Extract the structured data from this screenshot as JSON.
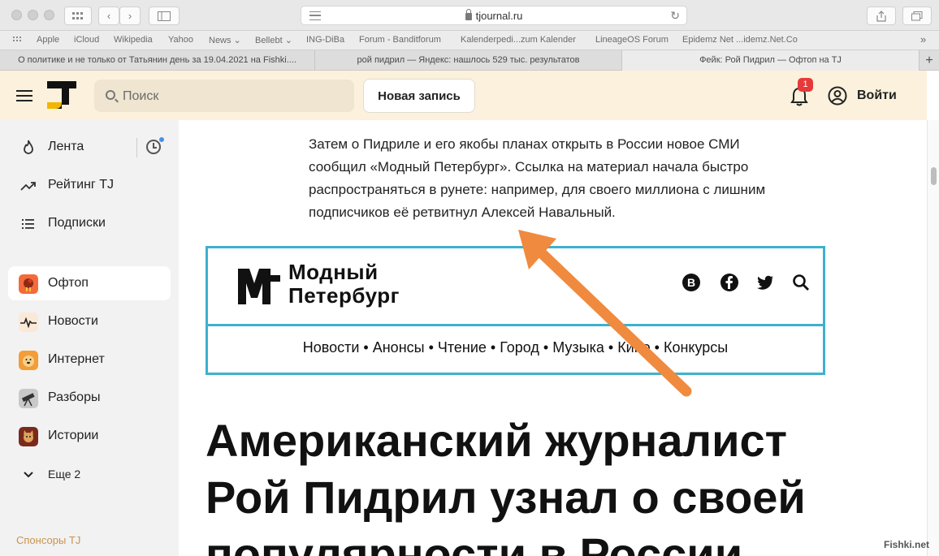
{
  "browser": {
    "url": "tjournal.ru",
    "bookmarks": [
      "Apple",
      "iCloud",
      "Wikipedia",
      "Yahoo",
      "News ⌄",
      "Bellebt ⌄",
      "ING-DiBa",
      "Forum - Banditforum",
      "Kalenderpedi...zum Kalender",
      "LineageOS Forum",
      "Epidemz Net ...idemz.Net.Co"
    ],
    "tabs": [
      "О политике и не только от Татьянин день за 19.04.2021 на Fishki....",
      "рой пидрил — Яндекс: нашлось 529 тыс. результатов",
      "Фейк: Рой Пидрил — Офтоп на TJ"
    ]
  },
  "header": {
    "search_placeholder": "Поиск",
    "new_post": "Новая запись",
    "notifications_count": "1",
    "login": "Войти"
  },
  "sidebar": {
    "top": [
      {
        "label": "Лента",
        "icon": "fire-icon"
      },
      {
        "label": "Рейтинг TJ",
        "icon": "trending-icon"
      },
      {
        "label": "Подписки",
        "icon": "list-icon"
      }
    ],
    "sections": [
      {
        "label": "Офтоп",
        "icon": "rooster-icon"
      },
      {
        "label": "Новости",
        "icon": "pulse-icon"
      },
      {
        "label": "Интернет",
        "icon": "doge-icon"
      },
      {
        "label": "Разборы",
        "icon": "telescope-icon"
      },
      {
        "label": "Истории",
        "icon": "cat-icon"
      }
    ],
    "more": "Еще 2",
    "sponsors": "Спонсоры TJ"
  },
  "article": {
    "paragraph": "Затем о Пидриле и его якобы планах открыть в России новое СМИ сообщил «Модный Петербург». Ссылка на материал начала быстро распространяться в рунете: например, для своего миллиона с лишним подписчиков её ретвитнул Алексей Навальный.",
    "embed": {
      "title_line1": "Модный",
      "title_line2": "Петербург",
      "nav": "Новости • Анонсы • Чтение • Город • Музыка • Кино • Конкурсы"
    },
    "headline": "Американский журналист Рой Пидрил узнал о своей популярности в России"
  },
  "watermark": "Fishki.net",
  "colors": {
    "header_bg": "#fbf1dc",
    "accent": "#f08a3e",
    "embed_border": "#3fb0ce"
  }
}
